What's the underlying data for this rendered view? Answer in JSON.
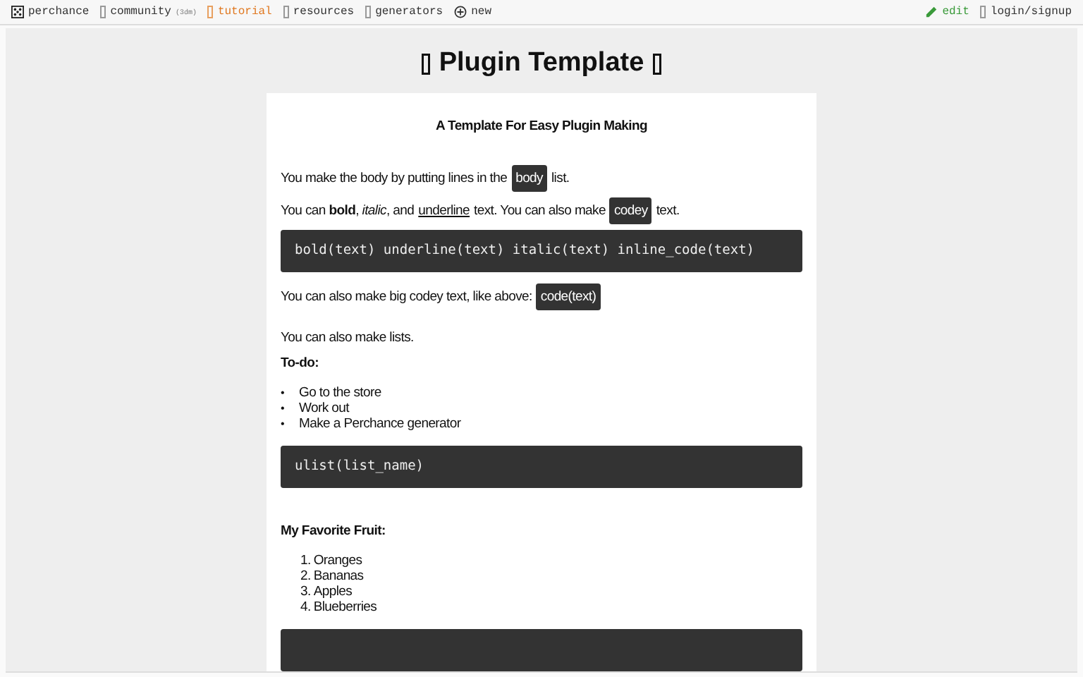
{
  "nav": {
    "left": [
      {
        "label": "perchance",
        "selected": false
      },
      {
        "label": "community",
        "note": "(3dm)",
        "selected": false
      },
      {
        "label": "tutorial",
        "selected": true
      },
      {
        "label": "resources",
        "selected": false
      },
      {
        "label": "generators",
        "selected": false
      },
      {
        "label": "new",
        "selected": false
      }
    ],
    "right": [
      {
        "label": "edit",
        "kind": "edit"
      },
      {
        "label": "login/signup",
        "kind": "plain"
      }
    ]
  },
  "page_title": "Plugin Template",
  "card": {
    "heading": "A Template For Easy Plugin Making",
    "blocks": [
      {
        "kind": "spacer"
      },
      {
        "kind": "paragraph",
        "parts": [
          {
            "kind": "text",
            "text": "You make the body by putting lines in the"
          },
          {
            "kind": "code",
            "text": "body"
          },
          {
            "kind": "text",
            "text": "list."
          }
        ]
      },
      {
        "kind": "paragraph",
        "parts": [
          {
            "kind": "text",
            "text": "You can **bold**, *italic*, and"
          },
          {
            "kind": "underline",
            "text": "underline"
          },
          {
            "kind": "text",
            "text": "text. You can also make"
          },
          {
            "kind": "code",
            "text": "codey"
          },
          {
            "kind": "text",
            "text": "text."
          }
        ]
      },
      {
        "kind": "codeblock",
        "text": "bold(text) underline(text) italic(text) inline_code(text)"
      },
      {
        "kind": "paragraph",
        "parts": [
          {
            "kind": "text",
            "text": "You can also make big codey text, like above:"
          },
          {
            "kind": "code",
            "text": "code(text)"
          }
        ]
      },
      {
        "kind": "spacer"
      },
      {
        "kind": "paragraph",
        "parts": [
          {
            "kind": "text",
            "text": "You can also make lists."
          }
        ]
      },
      {
        "kind": "label",
        "text": "To-do:"
      },
      {
        "kind": "bullets",
        "items": [
          {
            "marker": "•",
            "text": "Go to the store"
          },
          {
            "marker": "•",
            "text": "Work out"
          },
          {
            "marker": "•",
            "text": "Make a Perchance generator"
          }
        ]
      },
      {
        "kind": "codeblock",
        "text": "ulist(list_name)"
      },
      {
        "kind": "spacer"
      },
      {
        "kind": "spacer"
      },
      {
        "kind": "label",
        "text": "My Favorite Fruit:"
      },
      {
        "kind": "numbered",
        "items": [
          {
            "marker": "1.",
            "text": "Oranges"
          },
          {
            "marker": "2.",
            "text": "Bananas"
          },
          {
            "marker": "3.",
            "text": "Apples"
          },
          {
            "marker": "4.",
            "text": "Blueberries"
          }
        ]
      },
      {
        "kind": "codeblock"
      }
    ]
  }
}
